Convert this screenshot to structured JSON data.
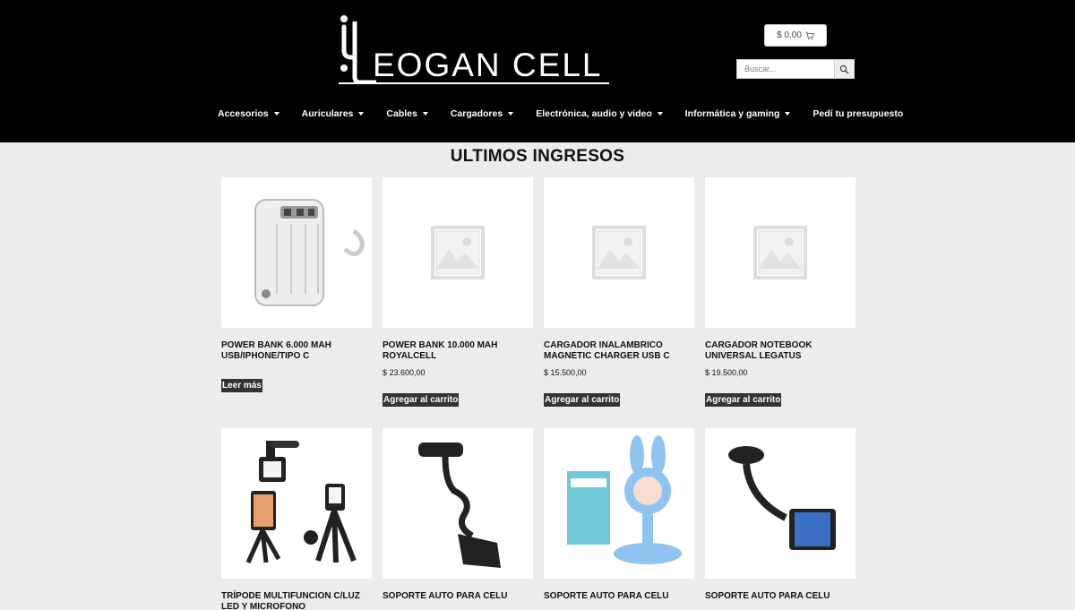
{
  "brand": {
    "logo_text": "EOGAN CELL"
  },
  "header": {
    "cart_total": "$ 0,00",
    "search_placeholder": "Buscar..."
  },
  "nav": [
    {
      "label": "Accesorios",
      "has_menu": true
    },
    {
      "label": "Auriculares",
      "has_menu": true
    },
    {
      "label": "Cables",
      "has_menu": true
    },
    {
      "label": "Cargadores",
      "has_menu": true
    },
    {
      "label": "Electrónica, audio y video",
      "has_menu": true
    },
    {
      "label": "Informática y gaming",
      "has_menu": true
    },
    {
      "label": "Pedí tu presupuesto",
      "has_menu": false
    }
  ],
  "section": {
    "title": "ULTIMOS INGRESOS"
  },
  "products": [
    {
      "title": "POWER BANK 6.000 MAH USB/IPHONE/TIPO C",
      "price": "",
      "button": "Leer más",
      "image": "power-bank-image"
    },
    {
      "title": "POWER BANK 10.000 MAH ROYALCELL",
      "price": "$ 23.600,00",
      "button": "Agregar al carrito",
      "image": "placeholder-image"
    },
    {
      "title": "CARGADOR INALAMBRICO MAGNETIC CHARGER USB C",
      "price": "$ 15.500,00",
      "button": "Agregar al carrito",
      "image": "placeholder-image"
    },
    {
      "title": "CARGADOR NOTEBOOK UNIVERSAL LEGATUS",
      "price": "$ 19.500,00",
      "button": "Agregar al carrito",
      "image": "placeholder-image"
    },
    {
      "title": "TRÍPODE MULTIFUNCION C/LUZ LED Y MICROFONO",
      "price": "",
      "button": "",
      "image": "tripod-image"
    },
    {
      "title": "SOPORTE AUTO PARA CELU",
      "price": "",
      "button": "",
      "image": "gooseneck-holder-image"
    },
    {
      "title": "SOPORTE AUTO PARA CELU",
      "price": "",
      "button": "",
      "image": "bunny-stand-image"
    },
    {
      "title": "SOPORTE AUTO PARA CELU",
      "price": "",
      "button": "",
      "image": "suction-holder-image"
    }
  ],
  "colors": {
    "header_bg": "#000000",
    "page_bg": "#ececec",
    "button_bg": "#333333"
  }
}
